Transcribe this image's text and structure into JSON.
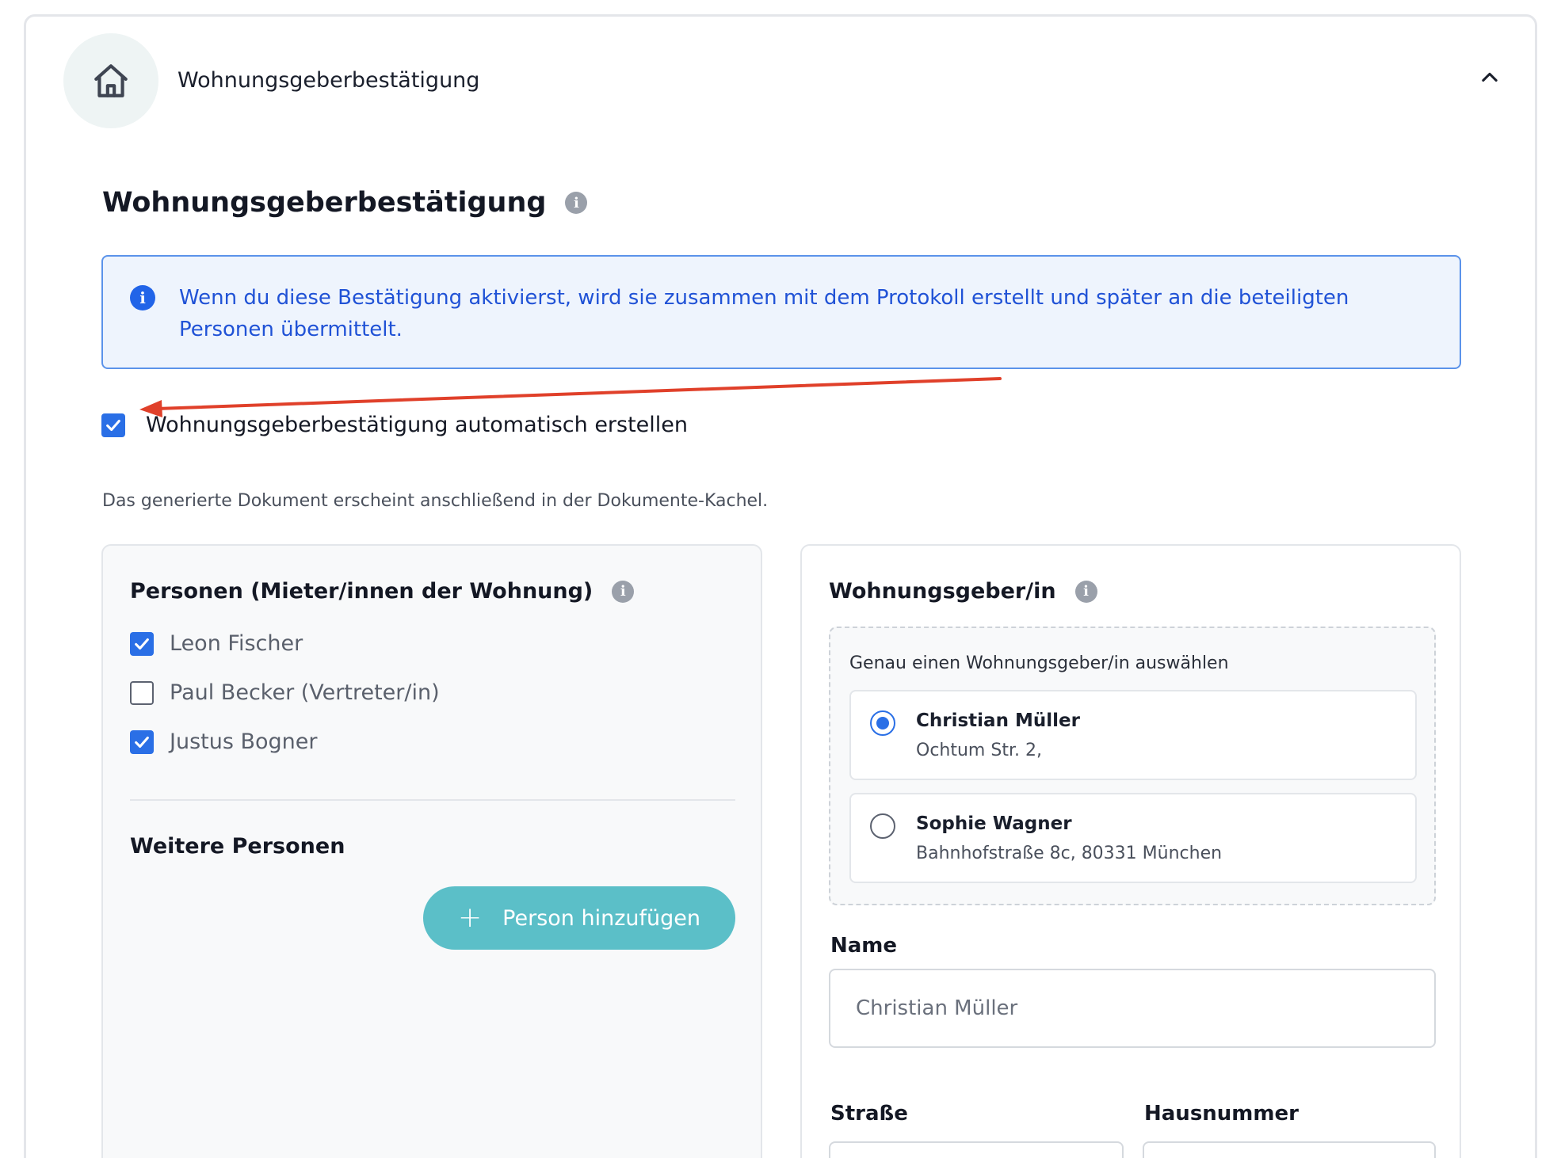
{
  "header": {
    "title": "Wohnungsgeberbestätigung"
  },
  "section": {
    "title": "Wohnungsgeberbestätigung"
  },
  "notice": {
    "text": "Wenn du diese Bestätigung aktivierst, wird sie zusammen mit dem Protokoll erstellt und später an die beteiligten Personen übermittelt."
  },
  "auto_create": {
    "label": "Wohnungsgeberbestätigung automatisch erstellen",
    "checked": true
  },
  "helper_text": "Das generierte Dokument erscheint anschließend in der Dokumente-Kachel.",
  "persons_panel": {
    "title": "Personen (Mieter/innen der Wohnung)",
    "persons": [
      {
        "name": "Leon Fischer",
        "checked": true
      },
      {
        "name": "Paul Becker (Vertreter/in)",
        "checked": false
      },
      {
        "name": "Justus Bogner",
        "checked": true
      }
    ],
    "more_title": "Weitere Personen",
    "add_button": "Person hinzufügen"
  },
  "landlord_panel": {
    "title": "Wohnungsgeber/in",
    "select_label": "Genau einen Wohnungsgeber/in auswählen",
    "options": [
      {
        "name": "Christian Müller",
        "address": "Ochtum Str. 2,",
        "selected": true
      },
      {
        "name": "Sophie Wagner",
        "address": "Bahnhofstraße 8c, 80331 München",
        "selected": false
      }
    ],
    "name_label": "Name",
    "name_placeholder": "Christian Müller",
    "street_label": "Straße",
    "house_number_label": "Hausnummer"
  },
  "colors": {
    "accent_blue": "#2a6fe6",
    "notice_text": "#2052d6",
    "add_button_bg": "#5bbfc8",
    "annotation_arrow": "#e0402a"
  }
}
